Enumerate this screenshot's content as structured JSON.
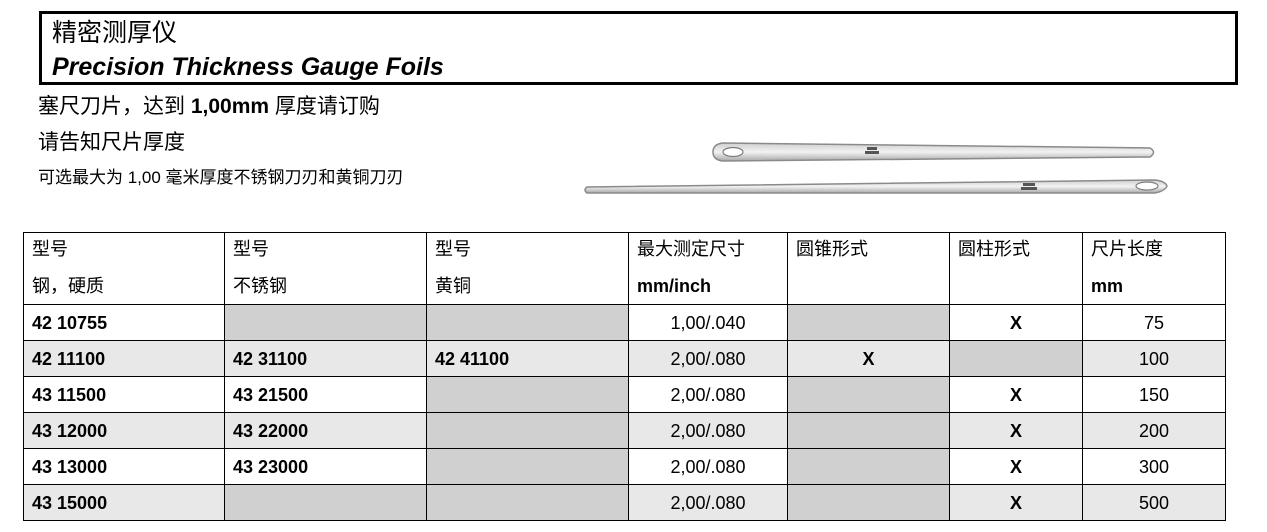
{
  "header": {
    "title_cn": "精密测厚仪",
    "title_en": "Precision Thickness Gauge Foils"
  },
  "subtitle": {
    "line1_prefix": "塞尺刀片，达到 ",
    "line1_bold": "1,00mm",
    "line1_suffix": " 厚度请订购",
    "line2": "请告知尺片厚度",
    "line3": "可选最大为 1,00 毫米厚度不锈钢刀刃和黄铜刀刃"
  },
  "table": {
    "headers": [
      {
        "line1": "型号",
        "line2": "钢，硬质"
      },
      {
        "line1": "型号",
        "line2": "不锈钢"
      },
      {
        "line1": "型号",
        "line2": "黄铜"
      },
      {
        "line1": "最大测定尺寸",
        "line2": "mm/inch"
      },
      {
        "line1": "圆锥形式",
        "line2": ""
      },
      {
        "line1": "圆柱形式",
        "line2": ""
      },
      {
        "line1": "尺片长度",
        "line2": "mm"
      }
    ],
    "rows": [
      {
        "steel": "42 10755",
        "stainless": "",
        "brass": "",
        "max": "1,00/.040",
        "cone": "",
        "cyl": "X",
        "length": "75"
      },
      {
        "steel": "42 11100",
        "stainless": "42 31100",
        "brass": "42 41100",
        "max": "2,00/.080",
        "cone": "X",
        "cyl": "",
        "length": "100"
      },
      {
        "steel": "43 11500",
        "stainless": "43 21500",
        "brass": "",
        "max": "2,00/.080",
        "cone": "",
        "cyl": "X",
        "length": "150"
      },
      {
        "steel": "43 12000",
        "stainless": "43 22000",
        "brass": "",
        "max": "2,00/.080",
        "cone": "",
        "cyl": "X",
        "length": "200"
      },
      {
        "steel": "43 13000",
        "stainless": "43 23000",
        "brass": "",
        "max": "2,00/.080",
        "cone": "",
        "cyl": "X",
        "length": "300"
      },
      {
        "steel": "43 15000",
        "stainless": "",
        "brass": "",
        "max": "2,00/.080",
        "cone": "",
        "cyl": "X",
        "length": "500"
      }
    ]
  }
}
